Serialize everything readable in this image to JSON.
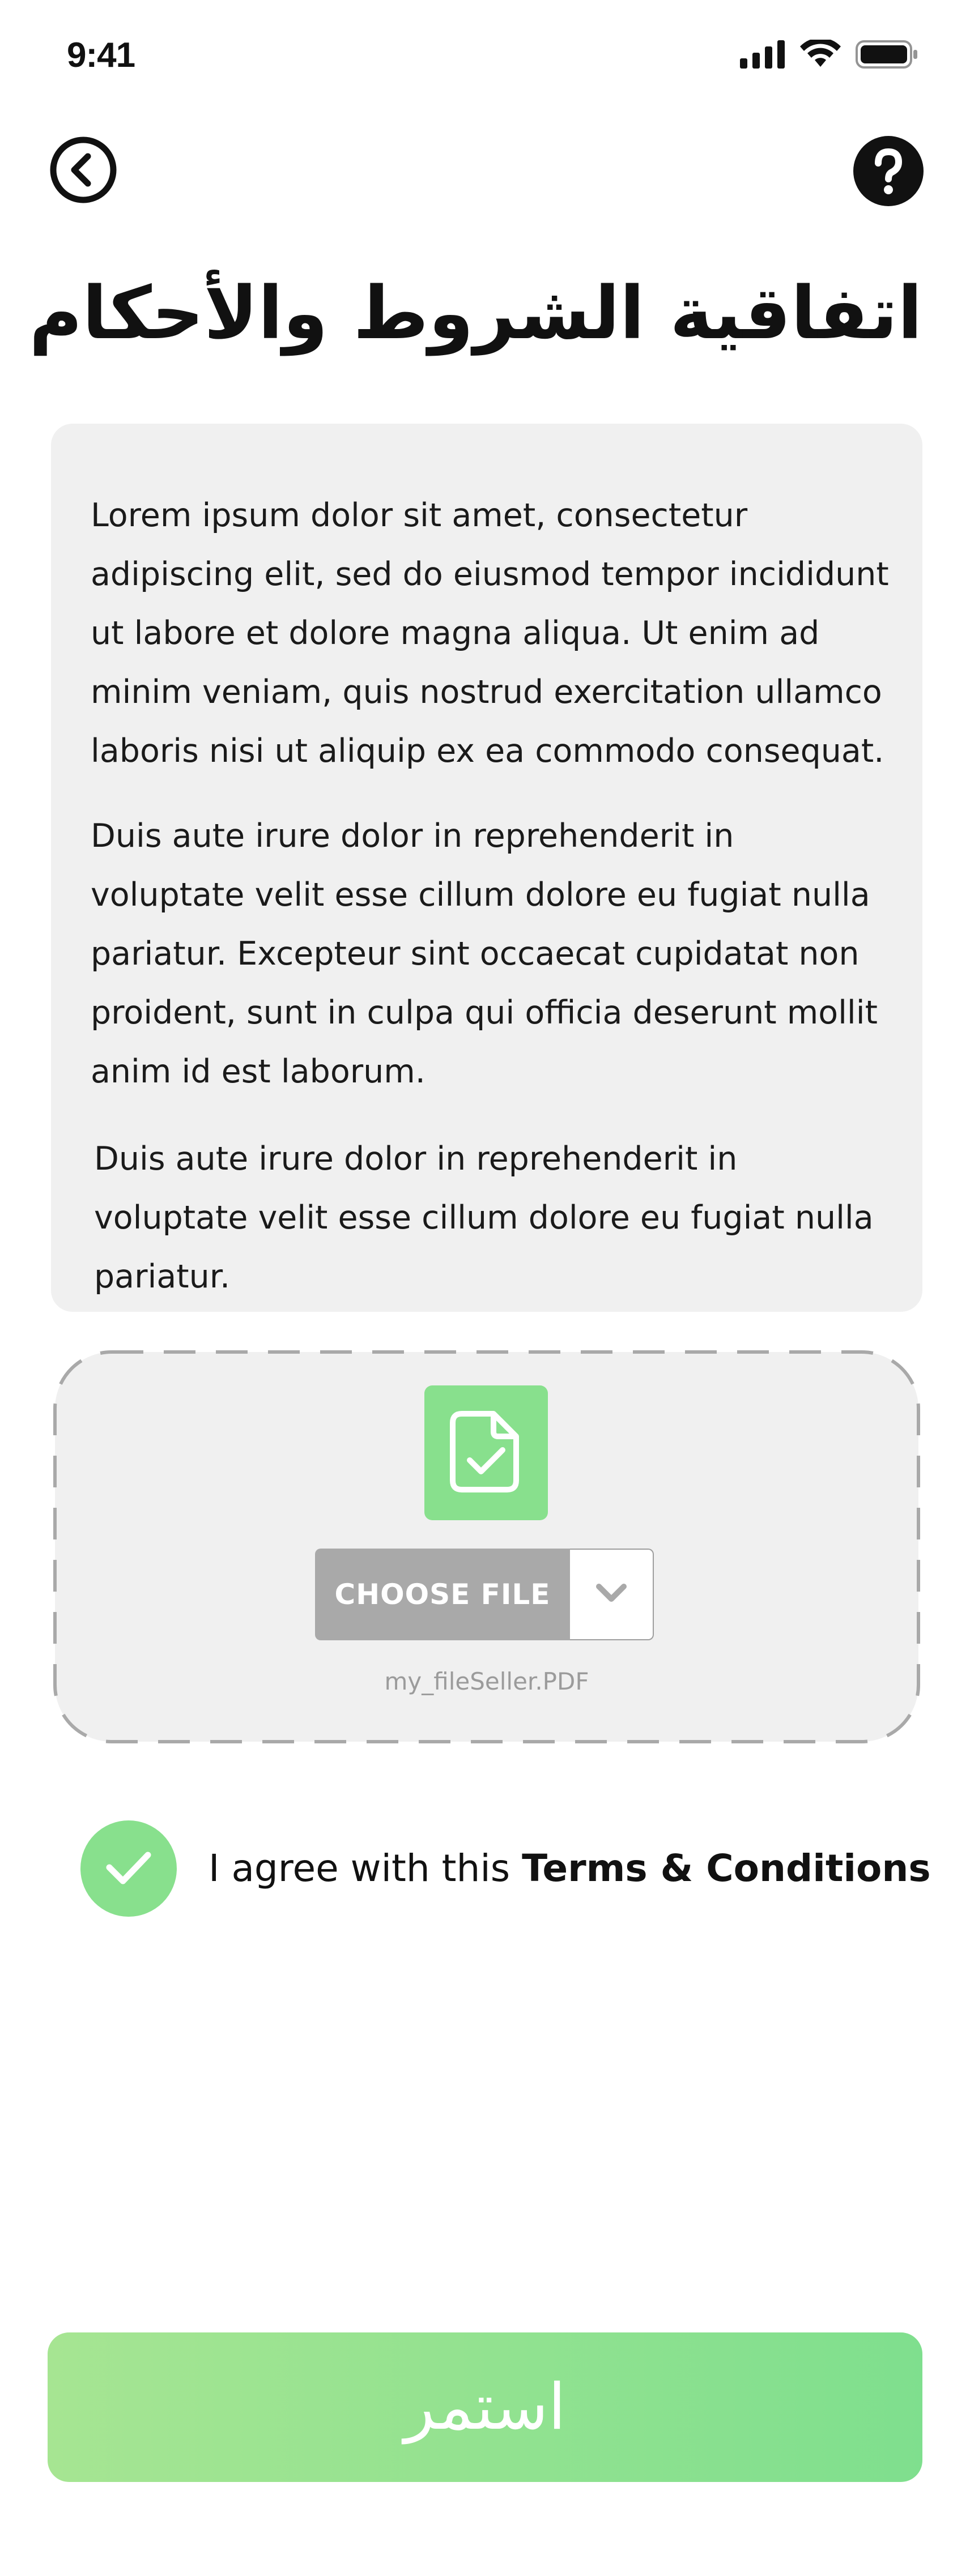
{
  "status_bar": {
    "time": "9:41",
    "icons": [
      "cellular-signal-icon",
      "wifi-icon",
      "battery-icon"
    ]
  },
  "header": {
    "back_icon": "chevron-left-circle-icon",
    "help_icon": "question-circle-icon",
    "title": "اتفاقية الشروط والأحكام"
  },
  "terms": {
    "paragraphs": [
      "Lorem ipsum dolor sit amet, consectetur adipiscing elit, sed do eiusmod tempor incididunt ut labore et dolore magna aliqua. Ut enim ad minim veniam, quis nostrud exercitation ullamco laboris nisi ut aliquip ex ea commodo consequat.",
      "Duis aute irure dolor in reprehenderit in voluptate velit esse cillum dolore eu fugiat nulla pariatur. Excepteur sint occaecat cupidatat non proident, sunt in culpa qui officia deserunt mollit anim id est laborum.",
      "Duis aute irure dolor in reprehenderit in voluptate velit esse cillum dolore eu fugiat nulla pariatur."
    ]
  },
  "upload": {
    "file_icon": "document-check-icon",
    "choose_file_label": "CHOOSE FILE",
    "dropdown_icon": "chevron-down-icon",
    "file_name": "my_fileSeller.PDF"
  },
  "agreement": {
    "checked": true,
    "check_icon": "checkmark-icon",
    "prefix": "I agree with this ",
    "link_text": "Terms & Conditions"
  },
  "footer": {
    "continue_label": "استمر"
  },
  "colors": {
    "accent_green": "#88e08d",
    "card_background": "#f0f0f0",
    "button_gradient_start": "#a6e592",
    "button_gradient_end": "#7fdf8e",
    "muted_gray": "#a9a9a9"
  }
}
